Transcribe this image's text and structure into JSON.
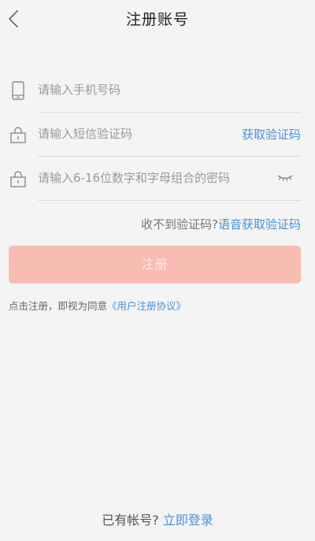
{
  "header": {
    "title": "注册账号",
    "back_icon": "chevron-left-icon"
  },
  "form": {
    "phone": {
      "placeholder": "请输入手机号码",
      "value": "",
      "icon": "phone-icon"
    },
    "sms_code": {
      "placeholder": "请输入短信验证码",
      "value": "",
      "icon": "lock-icon",
      "get_code_label": "获取验证码"
    },
    "password": {
      "placeholder": "请输入6-16位数字和字母组合的密码",
      "value": "",
      "icon": "lock-icon",
      "toggle_icon": "eye-closed-icon"
    },
    "voice": {
      "prompt": "收不到验证码?",
      "link": "语音获取验证码"
    },
    "register_label": "注册"
  },
  "agreement": {
    "prefix": "点击注册，即视为同意",
    "link": "《用户注册协议》"
  },
  "footer": {
    "prompt": "已有帐号?",
    "link": "立即登录"
  },
  "colors": {
    "background": "#f4f4f4",
    "link": "#4a90d9",
    "button": "#f7bcb2",
    "divider": "#dcdcdc"
  }
}
